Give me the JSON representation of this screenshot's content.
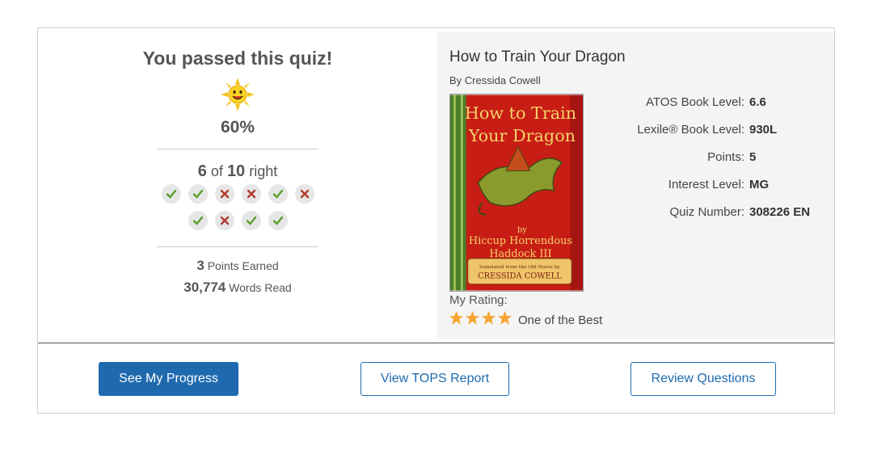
{
  "quiz": {
    "title": "You passed this quiz!",
    "percent": "60%",
    "right": "6",
    "of": "of",
    "total": "10",
    "right_word": "right",
    "answers": [
      true,
      true,
      false,
      false,
      true,
      false,
      true,
      false,
      true,
      true
    ],
    "points_earned_value": "3",
    "points_earned_label": "Points Earned",
    "words_read_value": "30,774",
    "words_read_label": "Words Read"
  },
  "book": {
    "title": "How to Train Your Dragon",
    "author": "By Cressida Cowell",
    "cover": {
      "title_line1": "How to Train",
      "title_line2": "Your Dragon",
      "by": "by",
      "author_line1": "Hiccup Horrendous",
      "author_line2": "Haddock III",
      "translated": "translated from the Old Norse by",
      "translator": "CRESSIDA COWELL"
    },
    "meta": [
      {
        "label": "ATOS Book Level:",
        "value": "6.6"
      },
      {
        "label": "Lexile® Book Level:",
        "value": "930L"
      },
      {
        "label": "Points:",
        "value": "5"
      },
      {
        "label": "Interest Level:",
        "value": "MG"
      },
      {
        "label": "Quiz Number:",
        "value": "308226 EN"
      }
    ],
    "rating_label": "My Rating:",
    "rating_stars": 4,
    "rating_text": "One of the Best"
  },
  "buttons": {
    "progress": "See My Progress",
    "tops": "View TOPS Report",
    "review": "Review Questions"
  },
  "colors": {
    "primary": "#1f6aaf",
    "correct": "#5aa02c",
    "incorrect": "#b03a2e",
    "star": "#f7a533"
  }
}
